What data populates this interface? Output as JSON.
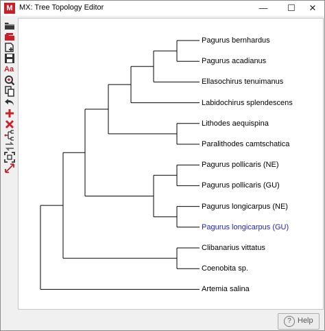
{
  "window": {
    "title": "MX: Tree Topology Editor",
    "app_icon_letter": "M",
    "minimize_glyph": "—",
    "maximize_glyph": "☐",
    "close_glyph": "✕"
  },
  "toolbar": {
    "icons": [
      "open-folder-icon",
      "open-red-icon",
      "add-file-icon",
      "save-icon",
      "font-icon",
      "zoom-icon",
      "copy-icon",
      "undo-icon",
      "add-icon",
      "delete-icon",
      "tree-layout-icon",
      "swap-icon",
      "fit-window-icon",
      "expand-icon"
    ],
    "font_label": "Aa"
  },
  "tree": {
    "leaves": [
      {
        "label": "Pagurus bernhardus",
        "selected": false
      },
      {
        "label": "Pagurus acadianus",
        "selected": false
      },
      {
        "label": "Ellasochirus tenuimanus",
        "selected": false
      },
      {
        "label": "Labidochirus splendescens",
        "selected": false
      },
      {
        "label": "Lithodes aequispina",
        "selected": false
      },
      {
        "label": "Paralithodes camtschatica",
        "selected": false
      },
      {
        "label": "Pagurus pollicaris (NE)",
        "selected": false
      },
      {
        "label": "Pagurus pollicaris (GU)",
        "selected": false
      },
      {
        "label": "Pagurus longicarpus (NE)",
        "selected": false
      },
      {
        "label": "Pagurus longicarpus (GU)",
        "selected": true
      },
      {
        "label": "Clibanarius vittatus",
        "selected": false
      },
      {
        "label": "Coenobita sp.",
        "selected": false
      },
      {
        "label": "Artemia salina",
        "selected": false
      }
    ],
    "selected_color": "#1f1fbf",
    "branch_color": "#000000"
  },
  "footer": {
    "help_label": "Help",
    "help_glyph": "?"
  }
}
